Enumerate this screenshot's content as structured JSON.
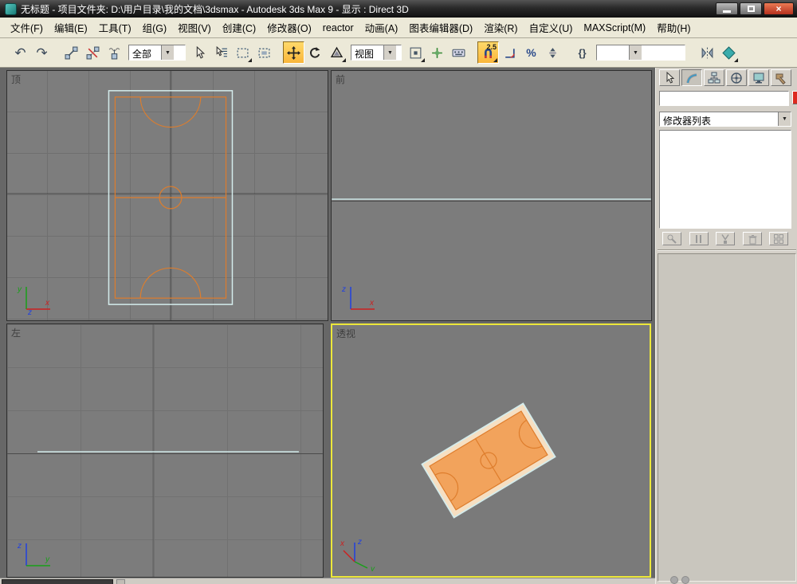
{
  "titlebar": {
    "title": "无标题 - 项目文件夹: D:\\用户目录\\我的文档\\3dsmax - Autodesk 3ds Max 9 - 显示 : Direct 3D",
    "close_glyph": "×"
  },
  "menu": {
    "items": [
      "文件(F)",
      "编辑(E)",
      "工具(T)",
      "组(G)",
      "视图(V)",
      "创建(C)",
      "修改器(O)",
      "reactor",
      "动画(A)",
      "图表编辑器(D)",
      "渲染(R)",
      "自定义(U)",
      "MAXScript(M)",
      "帮助(H)"
    ]
  },
  "toolbar": {
    "selection_filter_value": "全部",
    "coordinate_system_value": "视图",
    "snap_value": "2.5",
    "named_selection_value": ""
  },
  "icons": {
    "undo": "↶",
    "redo": "↷",
    "percent": "%",
    "named_sets": "{}",
    "combo_arrow": "▼",
    "strip_arrow": "◀"
  },
  "viewports": {
    "top": {
      "label": "顶"
    },
    "front": {
      "label": "前"
    },
    "left": {
      "label": "左"
    },
    "perspective": {
      "label": "透视"
    },
    "axis": {
      "x": "x",
      "y": "y",
      "z": "z"
    }
  },
  "command_panel": {
    "object_name_value": "",
    "modifier_list_label": "修改器列表"
  },
  "colors": {
    "active_viewport_border": "#ece73a",
    "toolbar_highlight": "#f9b63a",
    "court_fill": "#f2a35c",
    "court_line": "#de7d2c",
    "selection_outline": "#d4ecec",
    "object_color_swatch": "#dc2a20",
    "titlebar_background": "#1a1a1a"
  }
}
